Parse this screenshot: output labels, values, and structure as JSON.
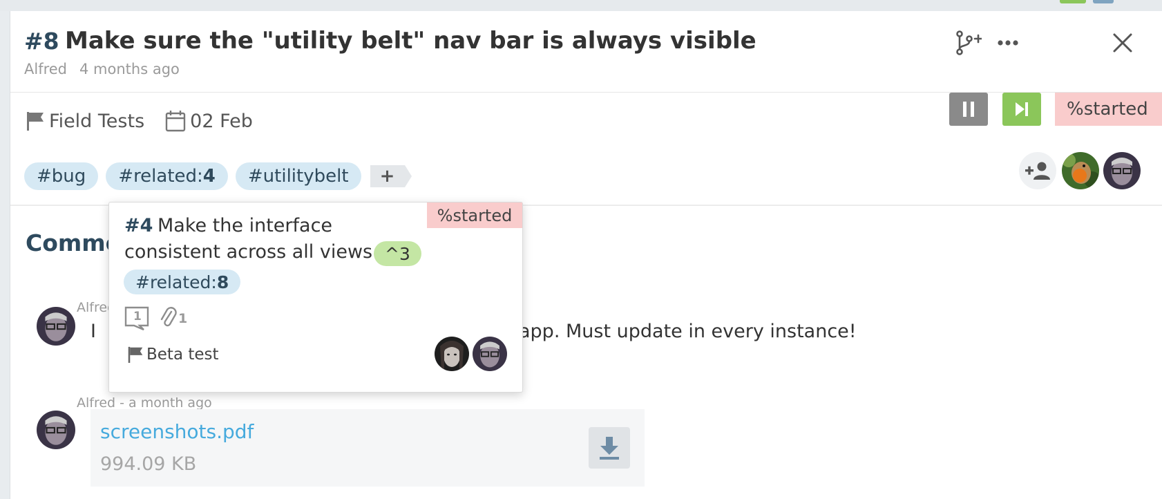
{
  "issue": {
    "number": "#8",
    "title": "Make sure the \"utility belt\" nav bar is always visible",
    "author": "Alfred",
    "created": "4 months ago",
    "milestone": "Field Tests",
    "due_date": "02 Feb",
    "status": "%started"
  },
  "header_icons": [
    "branch-add-icon",
    "more-icon",
    "close-icon"
  ],
  "tags": [
    {
      "prefix": "#bug",
      "value": ""
    },
    {
      "prefix": "#related:",
      "value": "4"
    },
    {
      "prefix": "#utilitybelt",
      "value": ""
    }
  ],
  "tag_add_label": "+",
  "comments": {
    "heading": "Comments",
    "items": [
      {
        "author_line": "Alfred - a month ago",
        "text_start": "I",
        "text_end": "app. Must update in every instance!"
      },
      {
        "author_line": "Alfred - a month ago"
      }
    ]
  },
  "attachment": {
    "file_name": "screenshots.pdf",
    "file_size": "994.09 KB"
  },
  "popover": {
    "status": "%started",
    "number": "#4",
    "title_line1": "Make the interface",
    "title_line2": "consistent across all views",
    "points": "^3",
    "tag_prefix": "#related:",
    "tag_value": "8",
    "comment_count": "1",
    "attachment_count": "1",
    "milestone": "Beta test"
  },
  "colors": {
    "accent_dark": "#2e4a5e",
    "tag_bg": "#d6e9f4",
    "status_bg": "#f9cccc",
    "success": "#8bc65a",
    "link": "#46aadd"
  }
}
